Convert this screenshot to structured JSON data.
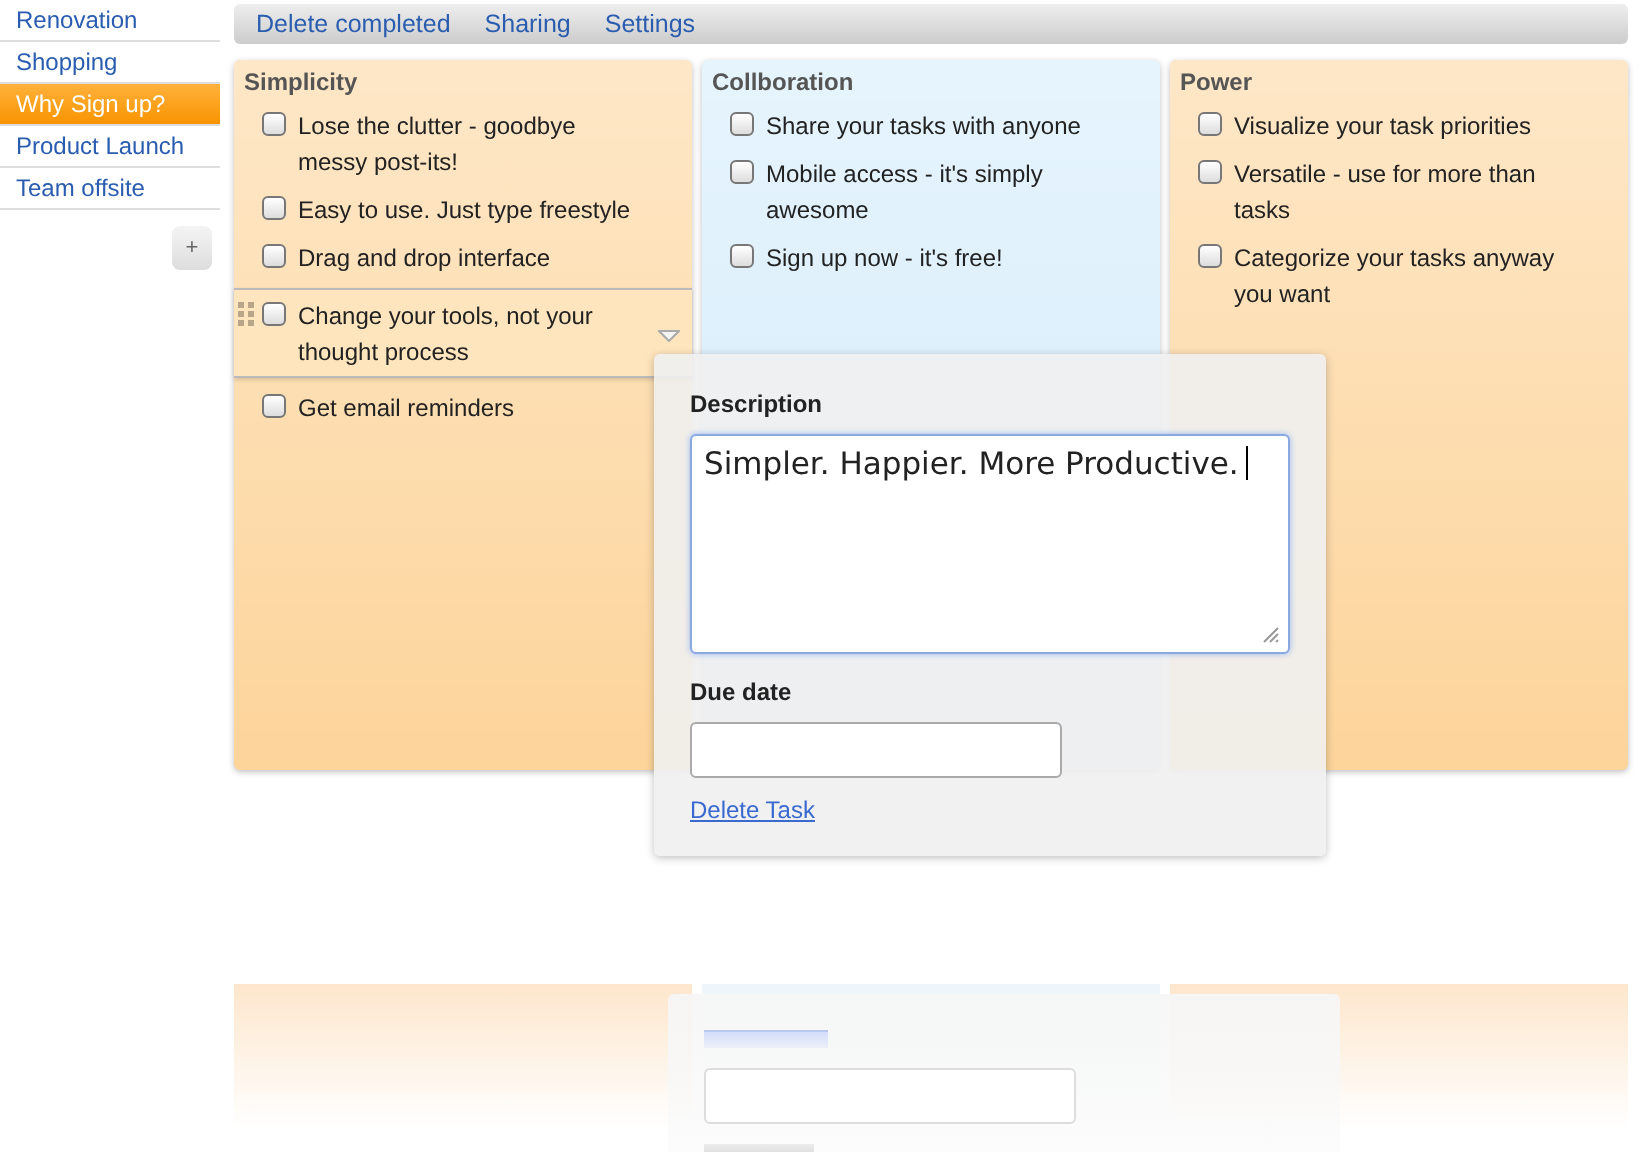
{
  "sidebar": {
    "items": [
      {
        "label": "Renovation",
        "selected": false
      },
      {
        "label": "Shopping",
        "selected": false
      },
      {
        "label": "Why Sign up?",
        "selected": true
      },
      {
        "label": "Product Launch",
        "selected": false
      },
      {
        "label": "Team offsite",
        "selected": false
      }
    ],
    "add_button": "+"
  },
  "toolbar": {
    "links": [
      "Delete completed",
      "Sharing",
      "Settings"
    ]
  },
  "columns": [
    {
      "title": "Simplicity",
      "color": "#fdd49a",
      "tasks": [
        {
          "text": "Lose the clutter - goodbye messy post-its!",
          "checked": false,
          "selected": false
        },
        {
          "text": "Easy to use. Just type freestyle",
          "checked": false,
          "selected": false
        },
        {
          "text": "Drag and drop interface",
          "checked": false,
          "selected": false
        },
        {
          "text": "Change your tools, not your thought process",
          "checked": false,
          "selected": true
        },
        {
          "text": "Get email reminders",
          "checked": false,
          "selected": false
        }
      ]
    },
    {
      "title": "Collboration",
      "color": "#d2ebfb",
      "tasks": [
        {
          "text": "Share your tasks with anyone",
          "checked": false,
          "selected": false
        },
        {
          "text": "Mobile access - it's simply awesome",
          "checked": false,
          "selected": false
        },
        {
          "text": "Sign up now - it's free!",
          "checked": false,
          "selected": false
        }
      ]
    },
    {
      "title": "Power",
      "color": "#fdd49a",
      "tasks": [
        {
          "text": "Visualize your task priorities",
          "checked": false,
          "selected": false
        },
        {
          "text": "Versatile - use for more than tasks",
          "checked": false,
          "selected": false
        },
        {
          "text": "Categorize your tasks anyway you want",
          "checked": false,
          "selected": false
        }
      ]
    }
  ],
  "task_editor": {
    "description_label": "Description",
    "description_value": "Simpler. Happier. More Productive.",
    "due_date_label": "Due date",
    "delete_link": "Delete Task"
  }
}
